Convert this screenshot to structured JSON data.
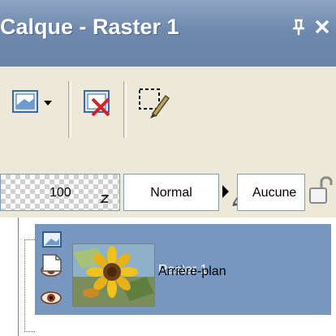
{
  "window": {
    "title": "Calque - Raster 1",
    "pin_glyph": "p",
    "close_glyph": "x"
  },
  "toolbar": {
    "items": [
      {
        "icon": "new-layer-icon",
        "has_dropdown": true
      },
      {
        "icon": "delete-layer-icon"
      },
      {
        "icon": "edit-selection-icon"
      }
    ]
  },
  "properties": {
    "opacity": "100",
    "opacity_marker": "₃",
    "blend_mode": "Normal",
    "mask": "Aucune"
  },
  "layers": [
    {
      "name": "Raster 1",
      "selected": true,
      "thumbnail": "transparent",
      "type_icon": "raster-layer-icon",
      "visible_icon": "eye-icon"
    },
    {
      "name": "Arrière-plan",
      "selected": false,
      "thumbnail": "sunflower-photo",
      "type_icon": "background-layer-icon",
      "visible_icon": "eye-icon"
    }
  ],
  "colors": {
    "title_bar": "#7f97b9",
    "selected_row": "#7797c0",
    "panel_bg": "#ece9d8",
    "list_bg": "#ffffff"
  }
}
